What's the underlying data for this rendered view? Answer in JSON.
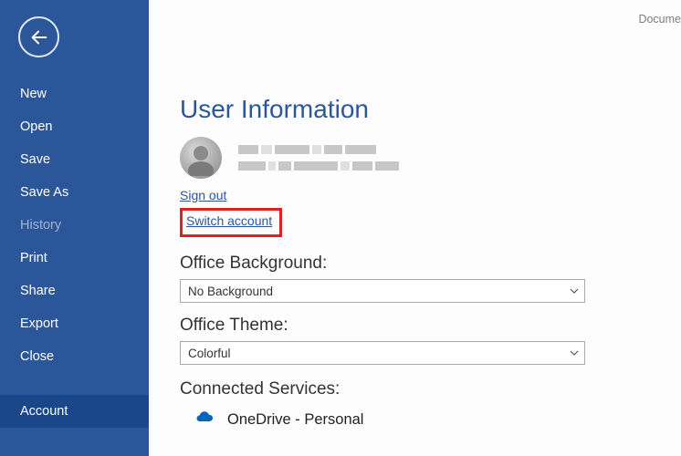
{
  "documentName": "Docume",
  "sidebar": {
    "items": [
      {
        "label": "New",
        "active": false,
        "dim": false
      },
      {
        "label": "Open",
        "active": false,
        "dim": false
      },
      {
        "label": "Save",
        "active": false,
        "dim": false
      },
      {
        "label": "Save As",
        "active": false,
        "dim": false
      },
      {
        "label": "History",
        "active": false,
        "dim": true
      },
      {
        "label": "Print",
        "active": false,
        "dim": false
      },
      {
        "label": "Share",
        "active": false,
        "dim": false
      },
      {
        "label": "Export",
        "active": false,
        "dim": false
      },
      {
        "label": "Close",
        "active": false,
        "dim": false
      },
      {
        "label": "Account",
        "active": true,
        "dim": false
      }
    ]
  },
  "main": {
    "title": "User Information",
    "signOutLabel": "Sign out",
    "switchAccountLabel": "Switch account",
    "backgroundLabel": "Office Background:",
    "backgroundValue": "No Background",
    "themeLabel": "Office Theme:",
    "themeValue": "Colorful",
    "connectedLabel": "Connected Services:",
    "serviceName": "OneDrive - Personal"
  },
  "colors": {
    "brand": "#2b579a",
    "sidebarActive": "#19478a",
    "highlight": "#e02020"
  }
}
